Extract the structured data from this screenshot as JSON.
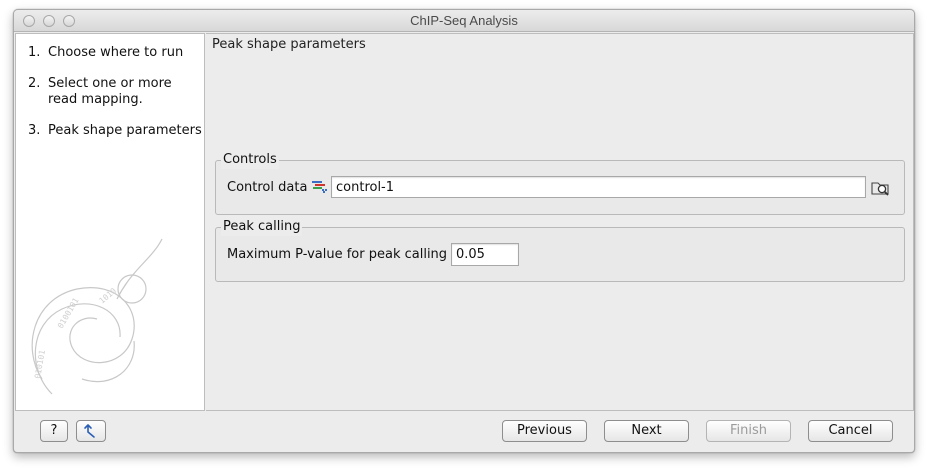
{
  "window": {
    "title": "ChIP-Seq Analysis"
  },
  "steps": [
    {
      "num": "1.",
      "label": "Choose where to run"
    },
    {
      "num": "2.",
      "label": "Select one or more read mapping."
    },
    {
      "num": "3.",
      "label": "Peak shape parameters"
    }
  ],
  "page": {
    "heading": "Peak shape parameters"
  },
  "controls": {
    "legend": "Controls",
    "control_data_label": "Control data",
    "control_data_value": "control-1",
    "data_icon": "read-mapping-icon",
    "browse_icon": "browse-folder-icon"
  },
  "peak_calling": {
    "legend": "Peak calling",
    "pvalue_label": "Maximum P-value for peak calling",
    "pvalue_value": "0.05"
  },
  "footer": {
    "help_label": "?",
    "reset_icon": "reset-arrow-icon",
    "previous_label": "Previous",
    "next_label": "Next",
    "finish_label": "Finish",
    "cancel_label": "Cancel"
  }
}
